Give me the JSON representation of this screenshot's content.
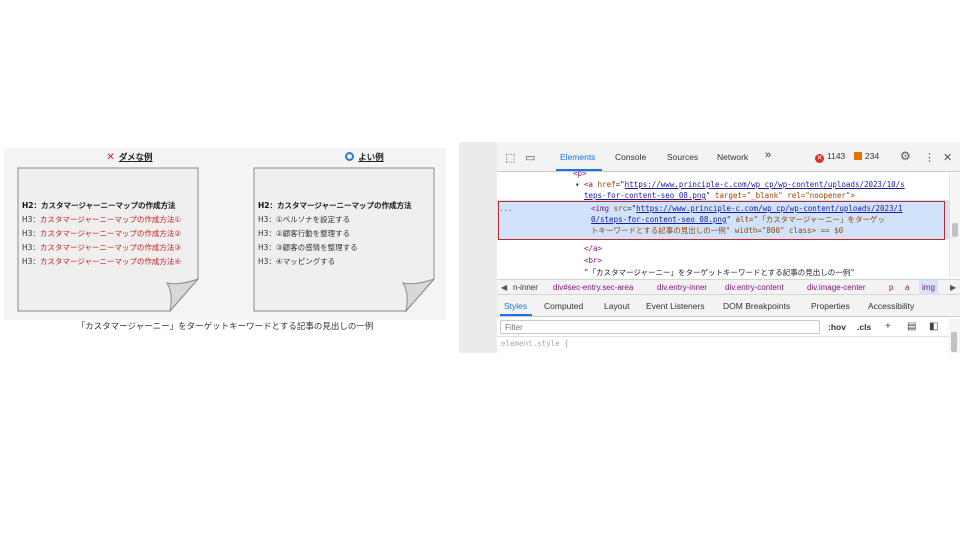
{
  "figure": {
    "bad": {
      "title": "ダメな例",
      "h2": "H2：カスタマージャーニーマップの作成方法",
      "h3": [
        {
          "prefix": "H3：",
          "text": "カスタマージャーニーマップの作成方法①"
        },
        {
          "prefix": "H3：",
          "text": "カスタマージャーニーマップの作成方法②"
        },
        {
          "prefix": "H3：",
          "text": "カスタマージャーニーマップの作成方法③"
        },
        {
          "prefix": "H3：",
          "text": "カスタマージャーニーマップの作成方法④"
        }
      ]
    },
    "good": {
      "title": "よい例",
      "h2": "H2：カスタマージャーニーマップの作成方法",
      "h3": [
        {
          "prefix": "H3：",
          "text": "①ペルソナを設定する"
        },
        {
          "prefix": "H3：",
          "text": "②顧客行動を整理する"
        },
        {
          "prefix": "H3：",
          "text": "③顧客の感情を整理する"
        },
        {
          "prefix": "H3：",
          "text": "④マッピングする"
        }
      ]
    },
    "caption": "「カスタマージャーニー」をターゲットキーワードとする記事の見出しの一例",
    "colors": {
      "bad_text": "#c8201c",
      "bad_mark": "#d21a1a",
      "good_mark": "#2a7bd8"
    }
  },
  "devtools": {
    "tabs": [
      "Elements",
      "Console",
      "Sources",
      "Network"
    ],
    "more_tabs": "»",
    "errors": "1143",
    "warnings": "234",
    "dom": {
      "line_p": "<p>",
      "a_open": "<a",
      "a_href_attr": "href",
      "a_href_val": "https://www.principle-c.com/wp_cp/wp-content/uploads/2023/10/s",
      "a_href_val2": "teps-for-content-seo_08.png",
      "a_target": "target=\"_blank\" rel=\"noopener\">",
      "img_open": "<img",
      "img_src_attr": "src",
      "img_src_val": "https://www.principle-c.com/wp_cp/wp-content/uploads/2023/1",
      "img_src_val2": "0/steps-for-content-seo_08.png",
      "img_alt": "alt=\"「カスタマージャーニー」をターゲッ",
      "img_alt2": "トキーワードとする記事の見出しの一例\" width=\"800\" class> == $0",
      "ellipsis": "...",
      "a_close": "</a>",
      "br": "<br>",
      "text_node": "\"「カスタマージャーニー」をターゲットキーワードとする記事の見出しの一例\""
    },
    "breadcrumbs": [
      "n-inner",
      "div#sec-entry.sec-area",
      "div.entry-inner",
      "div.entry-content",
      "div.image-center",
      "p",
      "a",
      "img"
    ],
    "sub_tabs": [
      "Styles",
      "Computed",
      "Layout",
      "Event Listeners",
      "DOM Breakpoints",
      "Properties",
      "Accessibility"
    ],
    "filter_placeholder": "Filter",
    "hov": ":hov",
    "cls": ".cls",
    "style_rule": "element.style {",
    "colors": {
      "accent": "#1a73e8",
      "error": "#d93025",
      "warning": "#e37400",
      "highlight_box": "#c0282d"
    }
  }
}
